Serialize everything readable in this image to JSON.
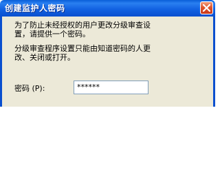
{
  "dialog": {
    "title": "创建监护人密码",
    "message_line1": "为了防止未经授权的用户更改分级审查设",
    "message_line2": "置，请提供一个密码。",
    "message_line3": "分级审查程序设置只能由知道密码的人更",
    "message_line4": "改、关闭或打开。",
    "password_label": "密码 (P):",
    "password_value": "******"
  },
  "colors": {
    "titlebar": "#0a5fd8",
    "window_body": "#ece9d8",
    "close_button": "#e0562d"
  },
  "icons": {
    "close": "close-icon"
  }
}
